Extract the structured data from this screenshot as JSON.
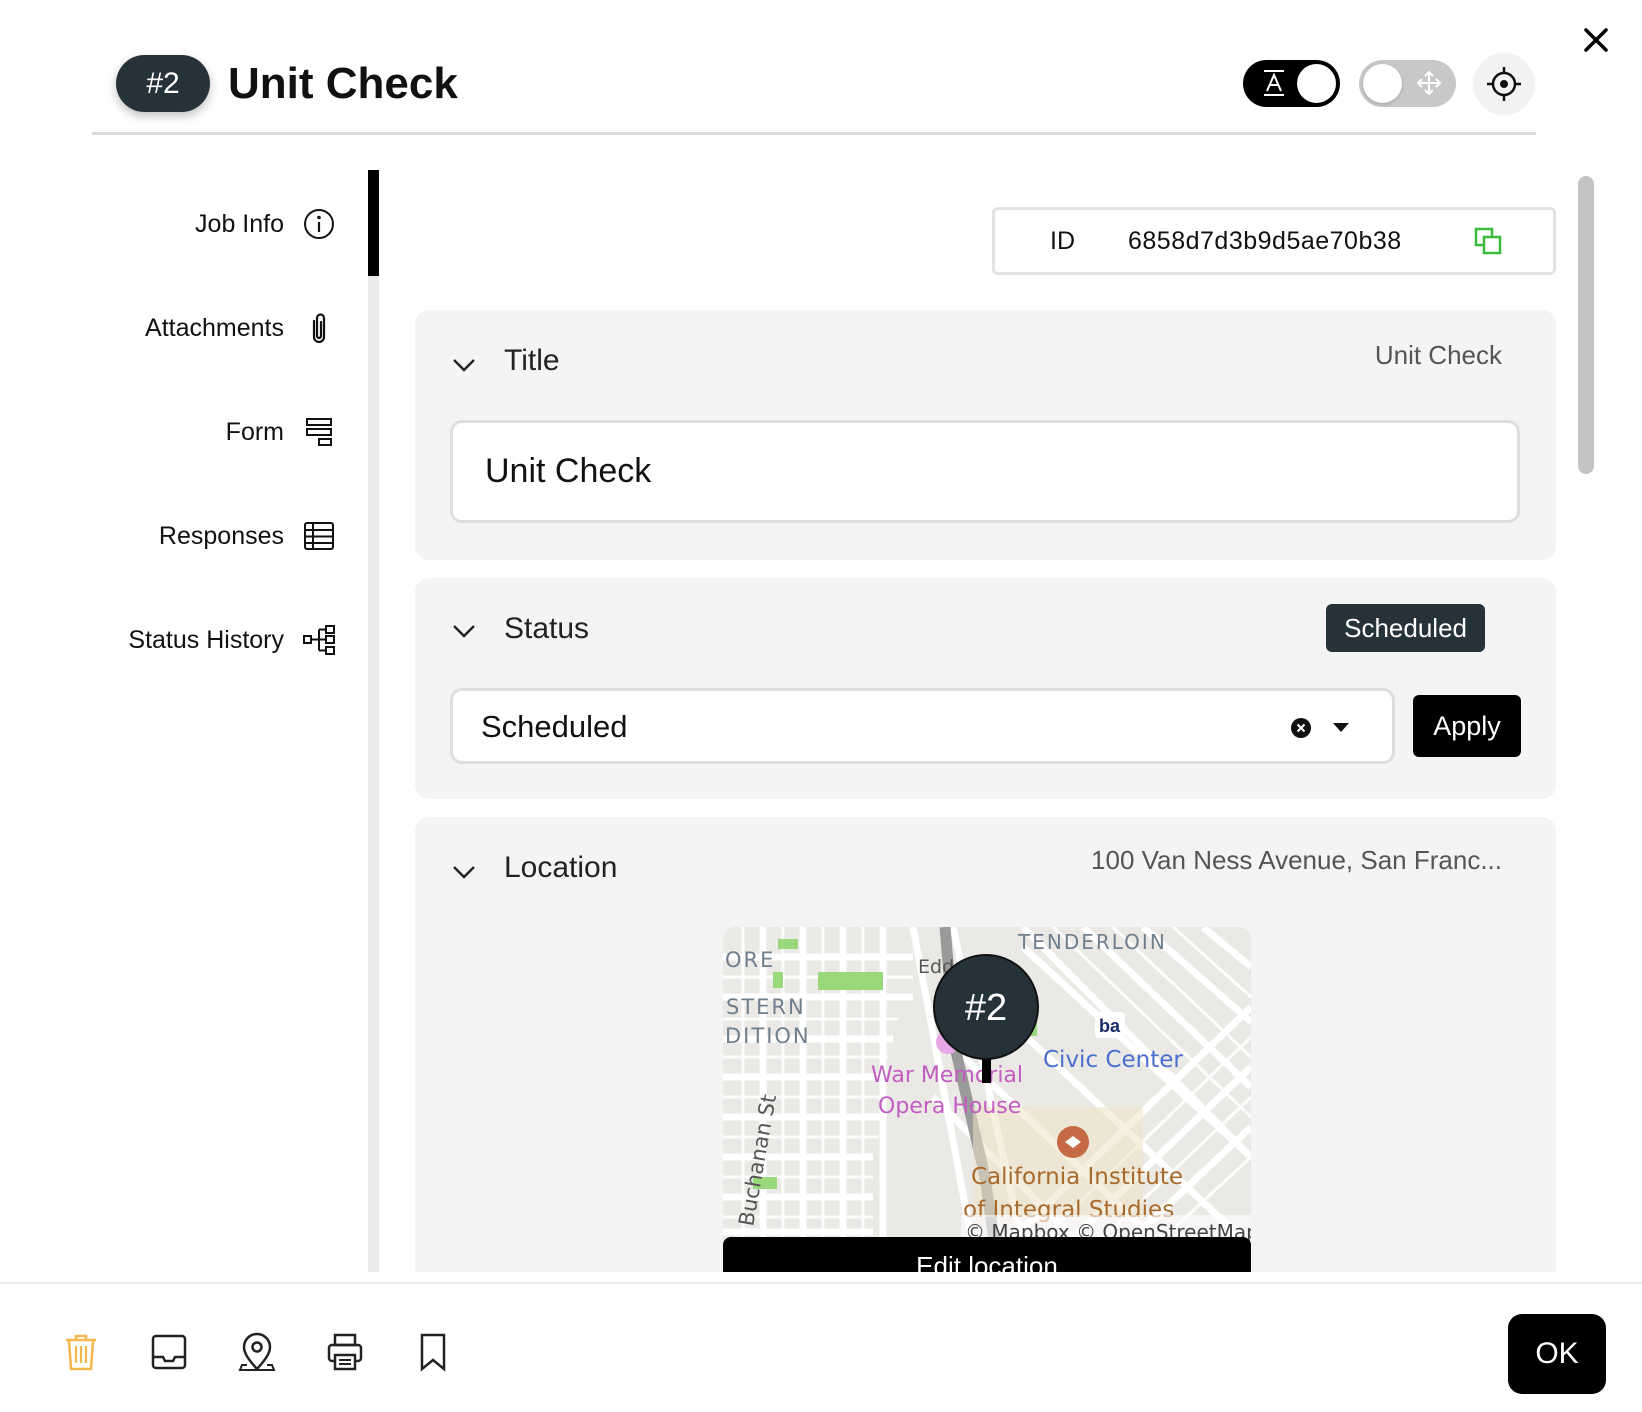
{
  "header": {
    "badge": "#2",
    "title": "Unit Check",
    "toggle_a": {
      "glyph": "text-format-icon",
      "on": true
    },
    "toggle_b": {
      "glyph": "move-icon",
      "on": false
    },
    "locate": "crosshair-icon",
    "close": "close-icon"
  },
  "sidebar": {
    "items": [
      {
        "label": "Job Info",
        "icon": "info-icon",
        "active": true
      },
      {
        "label": "Attachments",
        "icon": "paperclip-icon"
      },
      {
        "label": "Form",
        "icon": "form-icon"
      },
      {
        "label": "Responses",
        "icon": "table-icon"
      },
      {
        "label": "Status History",
        "icon": "tree-icon"
      }
    ]
  },
  "id_field": {
    "label": "ID",
    "value": "6858d7d3b9d5ae70b38",
    "icon": "copy-icon"
  },
  "title_section": {
    "heading": "Title",
    "summary": "Unit Check",
    "input_value": "Unit Check"
  },
  "status_section": {
    "heading": "Status",
    "badge": "Scheduled",
    "selected": "Scheduled",
    "apply_label": "Apply"
  },
  "location_section": {
    "heading": "Location",
    "summary": "100 Van Ness Avenue, San Franc...",
    "map": {
      "marker": "#2",
      "labels": {
        "ore": "ORE",
        "stern": "STERN",
        "dition": "DITION",
        "edd": "Edd",
        "tenderloin": "TENDERLOIN",
        "civic_center": "Civic Center",
        "war_memorial_1": "War Memorial",
        "war_memorial_2": "Opera House",
        "buchanan": "Buchanan St",
        "ciis_1": "California Institute",
        "ciis_2": "of Integral Studies",
        "attribution": "© Mapbox © OpenStreetMap",
        "bart": "ba"
      }
    },
    "edit_label": "Edit location"
  },
  "footer": {
    "icons": [
      "trash-icon",
      "inbox-icon",
      "map-pin-icon",
      "printer-icon",
      "bookmark-icon"
    ],
    "ok_label": "OK"
  },
  "colors": {
    "badge_bg": "#26323a",
    "trash": "#f2b84b",
    "accent_green": "#3dbb3d"
  }
}
